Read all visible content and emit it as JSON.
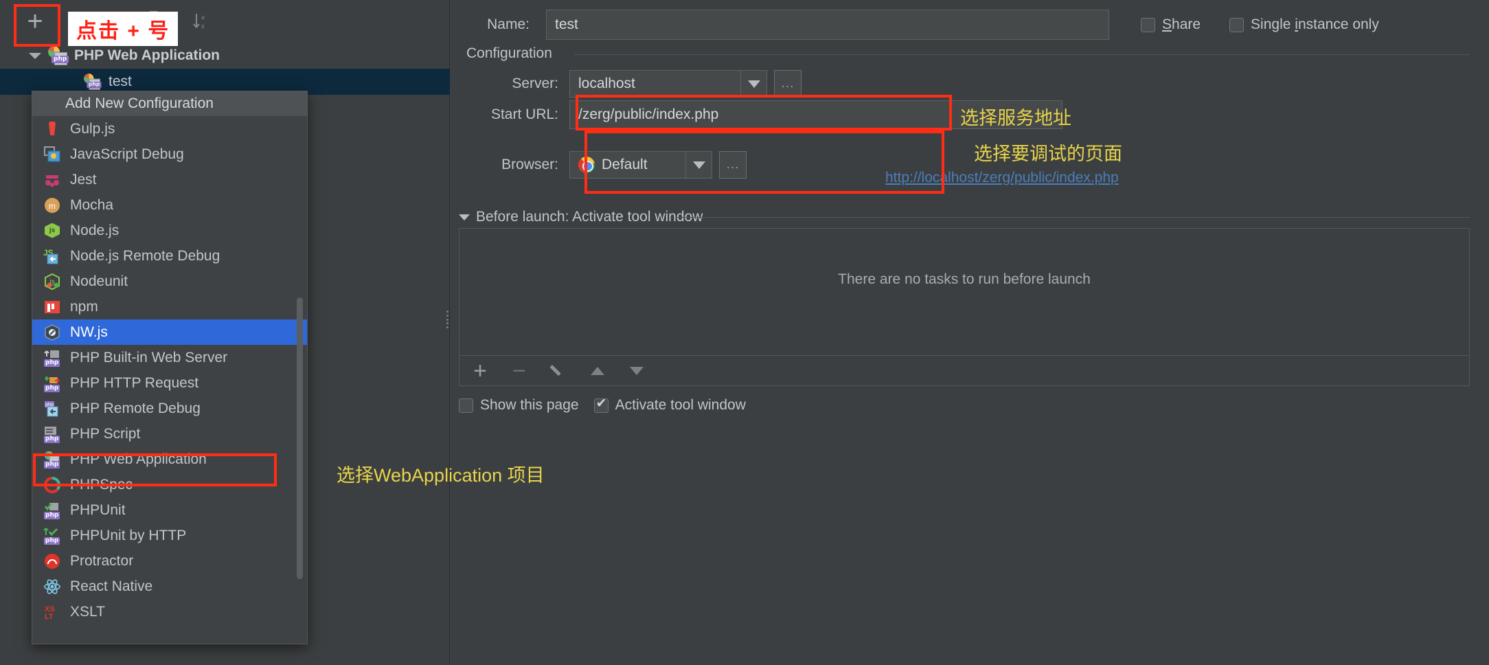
{
  "window": {
    "theme_bg": "#3c3f41",
    "accent_selection": "#2f68d8",
    "annotation_red": "#ff2d16",
    "annotation_yellow": "#e8d44b",
    "link_blue": "#4a7ebb"
  },
  "left_panel": {
    "toolbar": {
      "add_label": "+",
      "remove_label": "−",
      "copy_label": "▼",
      "folder_label": "folder",
      "sort_label": "sort"
    },
    "tree": [
      {
        "label": "PHP Web Application",
        "type": "group",
        "expanded": true
      },
      {
        "label": "test",
        "type": "config",
        "selected": true
      }
    ],
    "popup": {
      "title": "Add New Configuration",
      "items": [
        {
          "label": "Gulp.js",
          "icon": "gulp-icon",
          "selected": false
        },
        {
          "label": "JavaScript Debug",
          "icon": "javascript-debug-icon",
          "selected": false
        },
        {
          "label": "Jest",
          "icon": "jest-icon",
          "selected": false
        },
        {
          "label": "Mocha",
          "icon": "mocha-icon",
          "selected": false
        },
        {
          "label": "Node.js",
          "icon": "nodejs-icon",
          "selected": false
        },
        {
          "label": "Node.js Remote Debug",
          "icon": "nodejs-remote-icon",
          "selected": false
        },
        {
          "label": "Nodeunit",
          "icon": "nodeunit-icon",
          "selected": false
        },
        {
          "label": "npm",
          "icon": "npm-icon",
          "selected": false
        },
        {
          "label": "NW.js",
          "icon": "nwjs-icon",
          "selected": true
        },
        {
          "label": "PHP Built-in Web Server",
          "icon": "php-builtin-icon",
          "selected": false
        },
        {
          "label": "PHP HTTP Request",
          "icon": "php-http-icon",
          "selected": false
        },
        {
          "label": "PHP Remote Debug",
          "icon": "php-remote-icon",
          "selected": false
        },
        {
          "label": "PHP Script",
          "icon": "php-script-icon",
          "selected": false
        },
        {
          "label": "PHP Web Application",
          "icon": "php-web-icon",
          "selected": false
        },
        {
          "label": "PHPSpec",
          "icon": "phpspec-icon",
          "selected": false
        },
        {
          "label": "PHPUnit",
          "icon": "phpunit-icon",
          "selected": false
        },
        {
          "label": "PHPUnit by HTTP",
          "icon": "phpunit-http-icon",
          "selected": false
        },
        {
          "label": "Protractor",
          "icon": "protractor-icon",
          "selected": false
        },
        {
          "label": "React Native",
          "icon": "react-native-icon",
          "selected": false
        },
        {
          "label": "XSLT",
          "icon": "xslt-icon",
          "selected": false
        }
      ]
    }
  },
  "right_panel": {
    "name_label": "Name:",
    "name_value": "test",
    "share_label": "Share",
    "single_instance_label": "Single instance only",
    "share_checked": false,
    "single_instance_checked": false,
    "configuration_group": "Configuration",
    "server_label": "Server:",
    "server_value": "localhost",
    "start_url_label": "Start URL:",
    "start_url_value": "/zerg/public/index.php",
    "resolved_url": "http://localhost/zerg/public/index.php",
    "browser_label": "Browser:",
    "browser_value": "Default",
    "browser_icon": "chrome-icon",
    "ellipsis_label": "...",
    "before_launch_title": "Before launch: Activate tool window",
    "before_launch_empty": "There are no tasks to run before launch",
    "task_toolbar": {
      "add": "+",
      "remove": "−",
      "edit": "edit-pencil",
      "move_up": "move-up",
      "move_down": "move-down"
    },
    "show_page_label": "Show this page",
    "show_page_checked": false,
    "activate_tool_window_label": "Activate tool window",
    "activate_tool_window_checked": true
  },
  "annotations": {
    "click_plus": "点击 + 号",
    "choose_server_address": "选择服务地址",
    "choose_page_to_debug": "选择要调试的页面",
    "choose_webapplication_project": "选择WebApplication 项目"
  }
}
